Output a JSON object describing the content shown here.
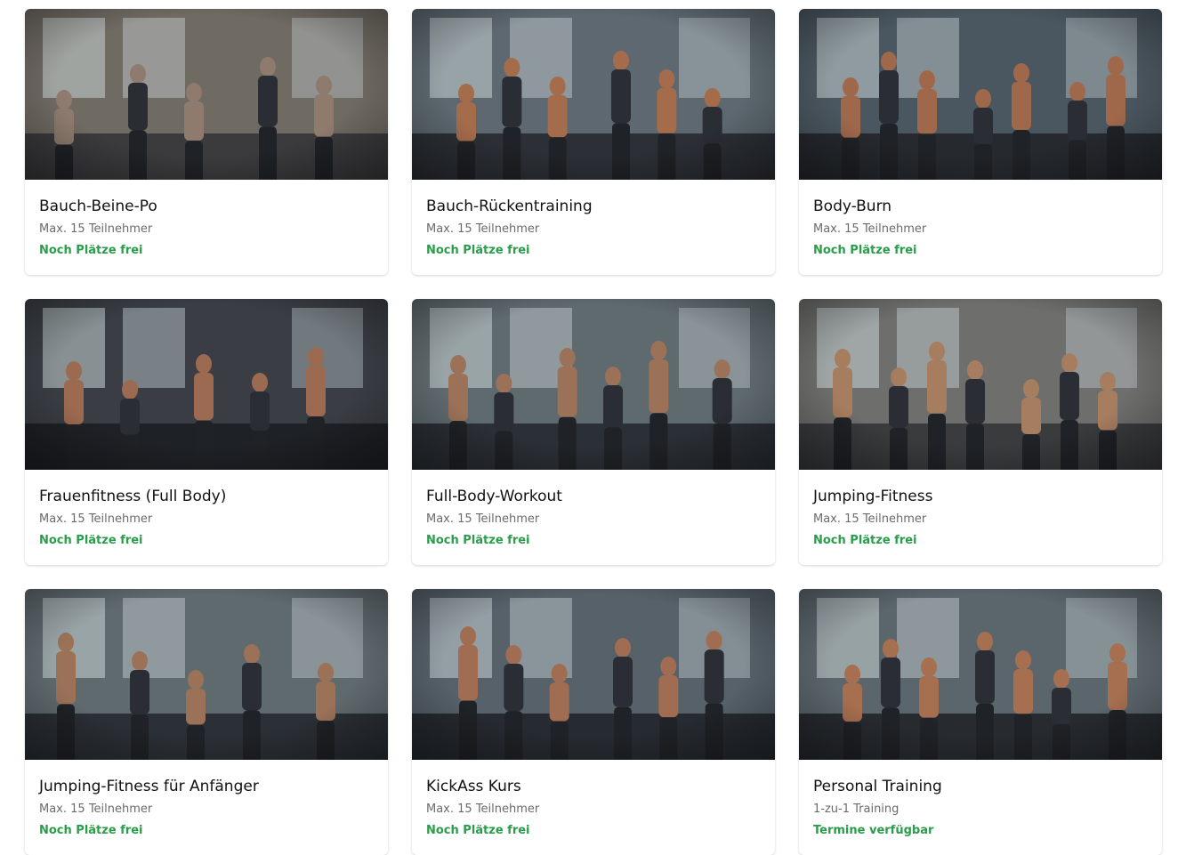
{
  "courses": [
    {
      "title": "Bauch-Beine-Po",
      "subtitle": "Max. 15 Teilnehmer",
      "status": "Noch Plätze frei",
      "scene": "mat-workout",
      "palette": [
        "#6f6a62",
        "#3b3a3d",
        "#8e7b6e"
      ]
    },
    {
      "title": "Bauch-Rückentraining",
      "subtitle": "Max. 15 Teilnehmer",
      "status": "Noch Plätze frei",
      "scene": "back-training",
      "palette": [
        "#5d6870",
        "#2c3036",
        "#a56c4c"
      ]
    },
    {
      "title": "Body-Burn",
      "subtitle": "Max. 15 Teilnehmer",
      "status": "Noch Plätze frei",
      "scene": "group-class",
      "palette": [
        "#4b5760",
        "#262a2f",
        "#a0684b"
      ]
    },
    {
      "title": "Frauenfitness (Full Body)",
      "subtitle": "Max. 15 Teilnehmer",
      "status": "Noch Plätze frei",
      "scene": "women-workout",
      "palette": [
        "#3a3e44",
        "#1e2126",
        "#9c6a50"
      ]
    },
    {
      "title": "Full-Body-Workout",
      "subtitle": "Max. 15 Teilnehmer",
      "status": "Noch Plätze frei",
      "scene": "arms-raised-group",
      "palette": [
        "#5f6a6f",
        "#2b3036",
        "#9b7258"
      ]
    },
    {
      "title": "Jumping-Fitness",
      "subtitle": "Max. 15 Teilnehmer",
      "status": "Noch Plätze frei",
      "scene": "trampoline",
      "palette": [
        "#6e6f6c",
        "#3a3b3d",
        "#a67d5e"
      ]
    },
    {
      "title": "Jumping-Fitness für Anfänger",
      "subtitle": "Max. 15 Teilnehmer",
      "status": "Noch Plätze frei",
      "scene": "arms-raised-group",
      "palette": [
        "#5f6a6f",
        "#2b3036",
        "#9b7258"
      ]
    },
    {
      "title": "KickAss Kurs",
      "subtitle": "Max. 15 Teilnehmer",
      "status": "Noch Plätze frei",
      "scene": "kickbox-group",
      "palette": [
        "#56616a",
        "#262b31",
        "#a06d52"
      ]
    },
    {
      "title": "Personal Training",
      "subtitle": "1-zu-1 Training",
      "status": "Termine verfügbar",
      "scene": "personal-training",
      "palette": [
        "#5b666c",
        "#272b30",
        "#a66f50"
      ]
    }
  ],
  "colors": {
    "status_green": "#2a9d4a",
    "title": "#111111",
    "subtitle": "#6b6b6b"
  }
}
